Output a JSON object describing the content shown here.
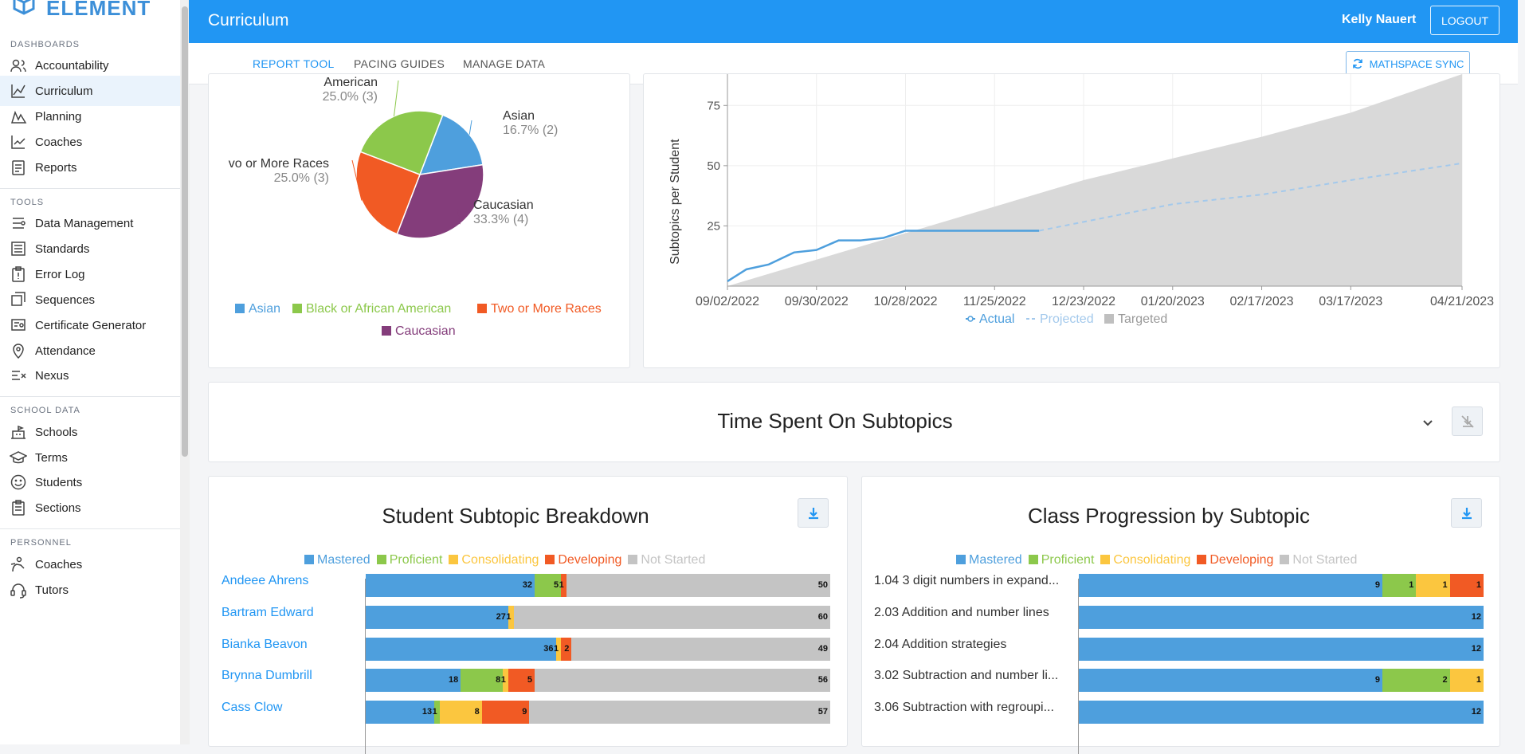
{
  "app": {
    "logo_text": "ELEMENT"
  },
  "sidebar": {
    "sections": [
      {
        "title": "DASHBOARDS",
        "items": [
          {
            "label": "Accountability",
            "icon": "users-icon"
          },
          {
            "label": "Curriculum",
            "icon": "line-chart-icon",
            "active": true
          },
          {
            "label": "Planning",
            "icon": "area-chart-icon"
          },
          {
            "label": "Coaches",
            "icon": "trend-chart-icon"
          },
          {
            "label": "Reports",
            "icon": "report-icon"
          }
        ]
      },
      {
        "title": "TOOLS",
        "items": [
          {
            "label": "Data Management",
            "icon": "database-icon"
          },
          {
            "label": "Standards",
            "icon": "list-icon"
          },
          {
            "label": "Error Log",
            "icon": "clipboard-alert-icon"
          },
          {
            "label": "Sequences",
            "icon": "sequence-icon"
          },
          {
            "label": "Certificate Generator",
            "icon": "certificate-icon"
          },
          {
            "label": "Attendance",
            "icon": "location-pin-icon"
          },
          {
            "label": "Nexus",
            "icon": "nexus-icon"
          }
        ]
      },
      {
        "title": "SCHOOL DATA",
        "items": [
          {
            "label": "Schools",
            "icon": "school-icon"
          },
          {
            "label": "Terms",
            "icon": "graduation-cap-icon"
          },
          {
            "label": "Students",
            "icon": "smiley-icon"
          },
          {
            "label": "Sections",
            "icon": "sections-icon"
          }
        ]
      },
      {
        "title": "PERSONNEL",
        "items": [
          {
            "label": "Coaches",
            "icon": "coach-icon"
          },
          {
            "label": "Tutors",
            "icon": "headset-icon"
          }
        ]
      }
    ]
  },
  "header": {
    "title": "Curriculum",
    "user": "Kelly Nauert",
    "logout": "LOGOUT"
  },
  "tabs": [
    {
      "label": "REPORT TOOL",
      "active": true
    },
    {
      "label": "PACING GUIDES"
    },
    {
      "label": "MANAGE DATA"
    }
  ],
  "sync_button": "MATHSPACE SYNC",
  "colors": {
    "mastered": "#4e9fdd",
    "proficient": "#8cc84b",
    "consolidating": "#fbc63f",
    "developing": "#f15a24",
    "not_started": "#c4c4c4",
    "caucasian": "#843d7b",
    "accent": "#2196f3"
  },
  "chart_data": [
    {
      "type": "pie",
      "slices": [
        {
          "label": "Asian",
          "percent": "16.7%",
          "count": 2,
          "value": 16.7,
          "color": "#4e9fdd",
          "label_text": "16.7% (2)"
        },
        {
          "label": "Caucasian",
          "percent": "33.3%",
          "count": 4,
          "value": 33.3,
          "color": "#843d7b",
          "label_text": "33.3% (4)"
        },
        {
          "label": "Two or More Races",
          "display_label": "vo or More Races",
          "percent": "25.0%",
          "count": 3,
          "value": 25.0,
          "color": "#f15a24",
          "label_text": "25.0% (3)"
        },
        {
          "label": "Black or African American",
          "display_label": "American",
          "percent": "25.0%",
          "count": 3,
          "value": 25.0,
          "color": "#8cc84b",
          "label_text": "25.0% (3)"
        }
      ],
      "legend": [
        {
          "label": "Asian",
          "color": "#4e9fdd"
        },
        {
          "label": "Black or African American",
          "color": "#8cc84b"
        },
        {
          "label": "Two or More Races",
          "color": "#f15a24"
        },
        {
          "label": "Caucasian",
          "color": "#843d7b"
        }
      ]
    },
    {
      "type": "line",
      "ylabel": "Subtopics per Student",
      "yticks": [
        25,
        50,
        75
      ],
      "ylim": [
        0,
        88
      ],
      "x_ticks": [
        "09/02/2022",
        "09/30/2022",
        "10/28/2022",
        "11/25/2022",
        "12/23/2022",
        "01/20/2023",
        "02/17/2023",
        "03/17/2023",
        "04/21/2023"
      ],
      "x_range": [
        "09/02/2022",
        "04/21/2023"
      ],
      "series": [
        {
          "name": "Actual",
          "style": "solid",
          "color": "#4e9fdd",
          "x": [
            "09/02/2022",
            "09/08/2022",
            "09/15/2022",
            "09/23/2022",
            "09/30/2022",
            "10/07/2022",
            "10/14/2022",
            "10/21/2022",
            "10/28/2022",
            "11/04/2022",
            "11/25/2022",
            "12/09/2022"
          ],
          "y": [
            2,
            7,
            9,
            14,
            15,
            19,
            19,
            20,
            23,
            23,
            23,
            23
          ]
        },
        {
          "name": "Projected",
          "style": "dashed",
          "color": "#a3c9ec",
          "x": [
            "12/09/2022",
            "01/20/2023",
            "02/17/2023",
            "03/17/2023",
            "04/21/2023"
          ],
          "y": [
            23,
            34,
            38,
            44,
            51
          ]
        },
        {
          "name": "Targeted",
          "style": "area",
          "color": "#d9d9d9",
          "x": [
            "09/02/2022",
            "09/30/2022",
            "10/28/2022",
            "11/25/2022",
            "12/23/2022",
            "01/20/2023",
            "02/17/2023",
            "03/17/2023",
            "04/21/2023"
          ],
          "y": [
            0,
            11,
            22,
            33,
            44,
            53,
            62,
            72,
            88
          ]
        }
      ],
      "legend": [
        "Actual",
        "Projected",
        "Targeted"
      ]
    },
    {
      "type": "bar",
      "stacked": true,
      "orientation": "horizontal",
      "title": "Student Subtopic Breakdown",
      "categories": [
        "Andeee Ahrens",
        "Bartram Edward",
        "Bianka Beavon",
        "Brynna Dumbrill",
        "Cass Clow"
      ],
      "series": [
        {
          "name": "Mastered",
          "values": [
            32,
            27,
            36,
            18,
            13
          ]
        },
        {
          "name": "Proficient",
          "values": [
            5,
            0,
            0,
            8,
            1
          ]
        },
        {
          "name": "Consolidating",
          "values": [
            0,
            1,
            1,
            1,
            8
          ]
        },
        {
          "name": "Developing",
          "values": [
            1,
            0,
            2,
            5,
            9
          ]
        },
        {
          "name": "Not Started",
          "values": [
            50,
            60,
            49,
            56,
            57
          ]
        }
      ]
    },
    {
      "type": "bar",
      "stacked": true,
      "orientation": "horizontal",
      "title": "Class Progression by Subtopic",
      "categories": [
        "1.04 3 digit numbers in expand...",
        "2.03 Addition and number lines",
        "2.04 Addition strategies",
        "3.02 Subtraction and number li...",
        "3.06 Subtraction with regroupi..."
      ],
      "series": [
        {
          "name": "Mastered",
          "values": [
            9,
            12,
            12,
            9,
            12
          ]
        },
        {
          "name": "Proficient",
          "values": [
            1,
            0,
            0,
            2,
            0
          ]
        },
        {
          "name": "Consolidating",
          "values": [
            1,
            0,
            0,
            1,
            0
          ]
        },
        {
          "name": "Developing",
          "values": [
            1,
            0,
            0,
            0,
            0
          ]
        },
        {
          "name": "Not Started",
          "values": [
            0,
            0,
            0,
            0,
            0
          ]
        }
      ]
    }
  ],
  "status_legend": [
    "Mastered",
    "Proficient",
    "Consolidating",
    "Developing",
    "Not Started"
  ],
  "time_spent": {
    "title": "Time Spent On Subtopics"
  }
}
